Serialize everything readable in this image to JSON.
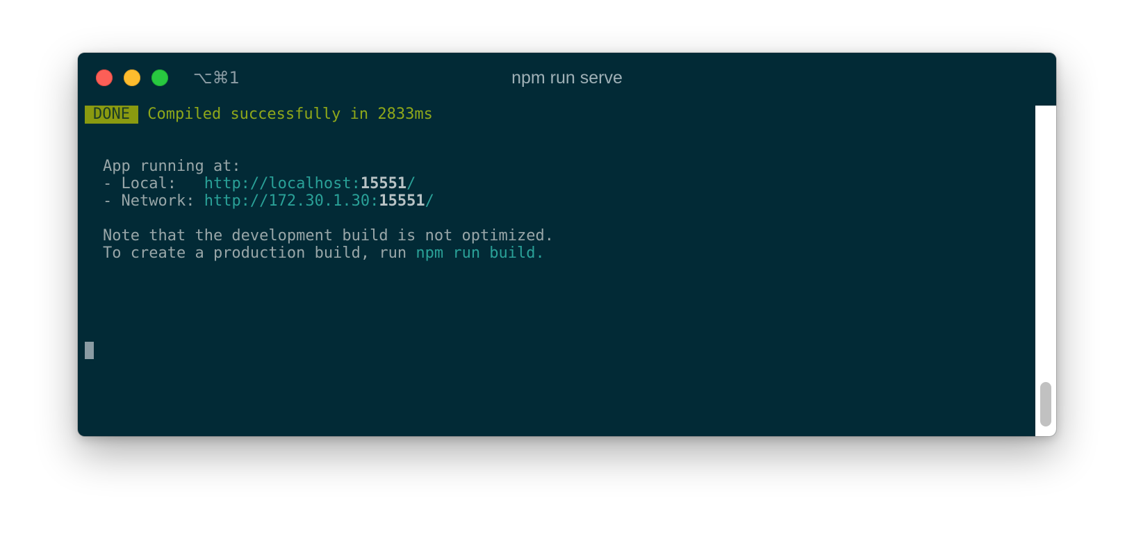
{
  "window": {
    "shortcut": "⌥⌘1",
    "title": "npm run serve"
  },
  "terminal": {
    "done_badge": "DONE",
    "compiled_message": "Compiled successfully in 2833ms",
    "app_running": "App running at:",
    "local_label": "- Local:   ",
    "local_url_prefix": "http://localhost:",
    "local_port": "15551",
    "local_url_suffix": "/",
    "network_label": "- Network: ",
    "network_url_prefix": "http://172.30.1.30:",
    "network_port": "15551",
    "network_url_suffix": "/",
    "note_line": "Note that the development build is not optimized.",
    "prod_line_prefix": "To create a production build, run ",
    "prod_command": "npm run build",
    "prod_line_suffix": "."
  },
  "colors": {
    "background": "#022a36",
    "badge_bg": "#8a9a10",
    "success": "#8fa81a",
    "link": "#2aa198",
    "text": "#98a6a8"
  }
}
